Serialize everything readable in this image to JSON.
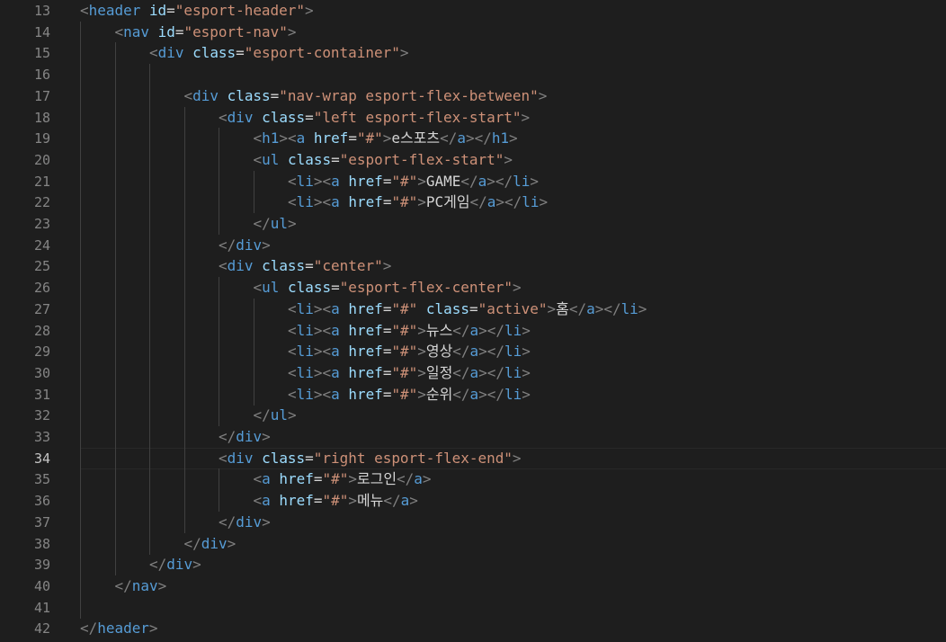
{
  "editor": {
    "language": "html",
    "theme": "dark",
    "colors": {
      "background": "#1e1e1e",
      "line_number": "#858585",
      "line_number_active": "#c6c6c6",
      "tag": "#569cd6",
      "attribute": "#9cdcfe",
      "string": "#ce9178",
      "punctuation": "#808080",
      "text": "#d4d4d4"
    },
    "active_line": 34,
    "lines": [
      {
        "num": "13",
        "indent": 1,
        "tokens": [
          [
            "p",
            "<"
          ],
          [
            "t",
            "header"
          ],
          [
            "s",
            " "
          ],
          [
            "a",
            "id"
          ],
          [
            "e",
            "="
          ],
          [
            "v",
            "\"esport-header\""
          ],
          [
            "p",
            ">"
          ]
        ]
      },
      {
        "num": "14",
        "indent": 2,
        "tokens": [
          [
            "p",
            "<"
          ],
          [
            "t",
            "nav"
          ],
          [
            "s",
            " "
          ],
          [
            "a",
            "id"
          ],
          [
            "e",
            "="
          ],
          [
            "v",
            "\"esport-nav\""
          ],
          [
            "p",
            ">"
          ]
        ]
      },
      {
        "num": "15",
        "indent": 3,
        "tokens": [
          [
            "p",
            "<"
          ],
          [
            "t",
            "div"
          ],
          [
            "s",
            " "
          ],
          [
            "a",
            "class"
          ],
          [
            "e",
            "="
          ],
          [
            "v",
            "\"esport-container\""
          ],
          [
            "p",
            ">"
          ]
        ]
      },
      {
        "num": "16",
        "indent": 4,
        "tokens": []
      },
      {
        "num": "17",
        "indent": 4,
        "tokens": [
          [
            "p",
            "<"
          ],
          [
            "t",
            "div"
          ],
          [
            "s",
            " "
          ],
          [
            "a",
            "class"
          ],
          [
            "e",
            "="
          ],
          [
            "v",
            "\"nav-wrap esport-flex-between\""
          ],
          [
            "p",
            ">"
          ]
        ]
      },
      {
        "num": "18",
        "indent": 5,
        "tokens": [
          [
            "p",
            "<"
          ],
          [
            "t",
            "div"
          ],
          [
            "s",
            " "
          ],
          [
            "a",
            "class"
          ],
          [
            "e",
            "="
          ],
          [
            "v",
            "\"left esport-flex-start\""
          ],
          [
            "p",
            ">"
          ]
        ]
      },
      {
        "num": "19",
        "indent": 6,
        "tokens": [
          [
            "p",
            "<"
          ],
          [
            "t",
            "h1"
          ],
          [
            "p",
            "><"
          ],
          [
            "t",
            "a"
          ],
          [
            "s",
            " "
          ],
          [
            "a",
            "href"
          ],
          [
            "e",
            "="
          ],
          [
            "v",
            "\"#\""
          ],
          [
            "p",
            ">"
          ],
          [
            "x",
            "e스포츠"
          ],
          [
            "p",
            "</"
          ],
          [
            "t",
            "a"
          ],
          [
            "p",
            "></"
          ],
          [
            "t",
            "h1"
          ],
          [
            "p",
            ">"
          ]
        ]
      },
      {
        "num": "20",
        "indent": 6,
        "tokens": [
          [
            "p",
            "<"
          ],
          [
            "t",
            "ul"
          ],
          [
            "s",
            " "
          ],
          [
            "a",
            "class"
          ],
          [
            "e",
            "="
          ],
          [
            "v",
            "\"esport-flex-start\""
          ],
          [
            "p",
            ">"
          ]
        ]
      },
      {
        "num": "21",
        "indent": 7,
        "tokens": [
          [
            "p",
            "<"
          ],
          [
            "t",
            "li"
          ],
          [
            "p",
            "><"
          ],
          [
            "t",
            "a"
          ],
          [
            "s",
            " "
          ],
          [
            "a",
            "href"
          ],
          [
            "e",
            "="
          ],
          [
            "v",
            "\"#\""
          ],
          [
            "p",
            ">"
          ],
          [
            "x",
            "GAME"
          ],
          [
            "p",
            "</"
          ],
          [
            "t",
            "a"
          ],
          [
            "p",
            "></"
          ],
          [
            "t",
            "li"
          ],
          [
            "p",
            ">"
          ]
        ]
      },
      {
        "num": "22",
        "indent": 7,
        "tokens": [
          [
            "p",
            "<"
          ],
          [
            "t",
            "li"
          ],
          [
            "p",
            "><"
          ],
          [
            "t",
            "a"
          ],
          [
            "s",
            " "
          ],
          [
            "a",
            "href"
          ],
          [
            "e",
            "="
          ],
          [
            "v",
            "\"#\""
          ],
          [
            "p",
            ">"
          ],
          [
            "x",
            "PC게임"
          ],
          [
            "p",
            "</"
          ],
          [
            "t",
            "a"
          ],
          [
            "p",
            "></"
          ],
          [
            "t",
            "li"
          ],
          [
            "p",
            ">"
          ]
        ]
      },
      {
        "num": "23",
        "indent": 6,
        "tokens": [
          [
            "p",
            "</"
          ],
          [
            "t",
            "ul"
          ],
          [
            "p",
            ">"
          ]
        ]
      },
      {
        "num": "24",
        "indent": 5,
        "tokens": [
          [
            "p",
            "</"
          ],
          [
            "t",
            "div"
          ],
          [
            "p",
            ">"
          ]
        ]
      },
      {
        "num": "25",
        "indent": 5,
        "tokens": [
          [
            "p",
            "<"
          ],
          [
            "t",
            "div"
          ],
          [
            "s",
            " "
          ],
          [
            "a",
            "class"
          ],
          [
            "e",
            "="
          ],
          [
            "v",
            "\"center\""
          ],
          [
            "p",
            ">"
          ]
        ]
      },
      {
        "num": "26",
        "indent": 6,
        "tokens": [
          [
            "p",
            "<"
          ],
          [
            "t",
            "ul"
          ],
          [
            "s",
            " "
          ],
          [
            "a",
            "class"
          ],
          [
            "e",
            "="
          ],
          [
            "v",
            "\"esport-flex-center\""
          ],
          [
            "p",
            ">"
          ]
        ]
      },
      {
        "num": "27",
        "indent": 7,
        "tokens": [
          [
            "p",
            "<"
          ],
          [
            "t",
            "li"
          ],
          [
            "p",
            "><"
          ],
          [
            "t",
            "a"
          ],
          [
            "s",
            " "
          ],
          [
            "a",
            "href"
          ],
          [
            "e",
            "="
          ],
          [
            "v",
            "\"#\""
          ],
          [
            "s",
            " "
          ],
          [
            "a",
            "class"
          ],
          [
            "e",
            "="
          ],
          [
            "v",
            "\"active\""
          ],
          [
            "p",
            ">"
          ],
          [
            "x",
            "홈"
          ],
          [
            "p",
            "</"
          ],
          [
            "t",
            "a"
          ],
          [
            "p",
            "></"
          ],
          [
            "t",
            "li"
          ],
          [
            "p",
            ">"
          ]
        ]
      },
      {
        "num": "28",
        "indent": 7,
        "tokens": [
          [
            "p",
            "<"
          ],
          [
            "t",
            "li"
          ],
          [
            "p",
            "><"
          ],
          [
            "t",
            "a"
          ],
          [
            "s",
            " "
          ],
          [
            "a",
            "href"
          ],
          [
            "e",
            "="
          ],
          [
            "v",
            "\"#\""
          ],
          [
            "p",
            ">"
          ],
          [
            "x",
            "뉴스"
          ],
          [
            "p",
            "</"
          ],
          [
            "t",
            "a"
          ],
          [
            "p",
            "></"
          ],
          [
            "t",
            "li"
          ],
          [
            "p",
            ">"
          ]
        ]
      },
      {
        "num": "29",
        "indent": 7,
        "tokens": [
          [
            "p",
            "<"
          ],
          [
            "t",
            "li"
          ],
          [
            "p",
            "><"
          ],
          [
            "t",
            "a"
          ],
          [
            "s",
            " "
          ],
          [
            "a",
            "href"
          ],
          [
            "e",
            "="
          ],
          [
            "v",
            "\"#\""
          ],
          [
            "p",
            ">"
          ],
          [
            "x",
            "영상"
          ],
          [
            "p",
            "</"
          ],
          [
            "t",
            "a"
          ],
          [
            "p",
            "></"
          ],
          [
            "t",
            "li"
          ],
          [
            "p",
            ">"
          ]
        ]
      },
      {
        "num": "30",
        "indent": 7,
        "tokens": [
          [
            "p",
            "<"
          ],
          [
            "t",
            "li"
          ],
          [
            "p",
            "><"
          ],
          [
            "t",
            "a"
          ],
          [
            "s",
            " "
          ],
          [
            "a",
            "href"
          ],
          [
            "e",
            "="
          ],
          [
            "v",
            "\"#\""
          ],
          [
            "p",
            ">"
          ],
          [
            "x",
            "일정"
          ],
          [
            "p",
            "</"
          ],
          [
            "t",
            "a"
          ],
          [
            "p",
            "></"
          ],
          [
            "t",
            "li"
          ],
          [
            "p",
            ">"
          ]
        ]
      },
      {
        "num": "31",
        "indent": 7,
        "tokens": [
          [
            "p",
            "<"
          ],
          [
            "t",
            "li"
          ],
          [
            "p",
            "><"
          ],
          [
            "t",
            "a"
          ],
          [
            "s",
            " "
          ],
          [
            "a",
            "href"
          ],
          [
            "e",
            "="
          ],
          [
            "v",
            "\"#\""
          ],
          [
            "p",
            ">"
          ],
          [
            "x",
            "순위"
          ],
          [
            "p",
            "</"
          ],
          [
            "t",
            "a"
          ],
          [
            "p",
            "></"
          ],
          [
            "t",
            "li"
          ],
          [
            "p",
            ">"
          ]
        ]
      },
      {
        "num": "32",
        "indent": 6,
        "tokens": [
          [
            "p",
            "</"
          ],
          [
            "t",
            "ul"
          ],
          [
            "p",
            ">"
          ]
        ]
      },
      {
        "num": "33",
        "indent": 5,
        "tokens": [
          [
            "p",
            "</"
          ],
          [
            "t",
            "div"
          ],
          [
            "p",
            ">"
          ]
        ]
      },
      {
        "num": "34",
        "indent": 5,
        "tokens": [
          [
            "p",
            "<"
          ],
          [
            "t",
            "div"
          ],
          [
            "s",
            " "
          ],
          [
            "a",
            "class"
          ],
          [
            "e",
            "="
          ],
          [
            "v",
            "\"right esport-flex-end\""
          ],
          [
            "p",
            ">"
          ]
        ]
      },
      {
        "num": "35",
        "indent": 6,
        "tokens": [
          [
            "p",
            "<"
          ],
          [
            "t",
            "a"
          ],
          [
            "s",
            " "
          ],
          [
            "a",
            "href"
          ],
          [
            "e",
            "="
          ],
          [
            "v",
            "\"#\""
          ],
          [
            "p",
            ">"
          ],
          [
            "x",
            "로그인"
          ],
          [
            "p",
            "</"
          ],
          [
            "t",
            "a"
          ],
          [
            "p",
            ">"
          ]
        ]
      },
      {
        "num": "36",
        "indent": 6,
        "tokens": [
          [
            "p",
            "<"
          ],
          [
            "t",
            "a"
          ],
          [
            "s",
            " "
          ],
          [
            "a",
            "href"
          ],
          [
            "e",
            "="
          ],
          [
            "v",
            "\"#\""
          ],
          [
            "p",
            ">"
          ],
          [
            "x",
            "메뉴"
          ],
          [
            "p",
            "</"
          ],
          [
            "t",
            "a"
          ],
          [
            "p",
            ">"
          ]
        ]
      },
      {
        "num": "37",
        "indent": 5,
        "tokens": [
          [
            "p",
            "</"
          ],
          [
            "t",
            "div"
          ],
          [
            "p",
            ">"
          ]
        ]
      },
      {
        "num": "38",
        "indent": 4,
        "tokens": [
          [
            "p",
            "</"
          ],
          [
            "t",
            "div"
          ],
          [
            "p",
            ">"
          ]
        ]
      },
      {
        "num": "39",
        "indent": 3,
        "tokens": [
          [
            "p",
            "</"
          ],
          [
            "t",
            "div"
          ],
          [
            "p",
            ">"
          ]
        ]
      },
      {
        "num": "40",
        "indent": 2,
        "tokens": [
          [
            "p",
            "</"
          ],
          [
            "t",
            "nav"
          ],
          [
            "p",
            ">"
          ]
        ]
      },
      {
        "num": "41",
        "indent": 2,
        "tokens": []
      },
      {
        "num": "42",
        "indent": 1,
        "tokens": [
          [
            "p",
            "</"
          ],
          [
            "t",
            "header"
          ],
          [
            "p",
            ">"
          ]
        ]
      }
    ]
  }
}
